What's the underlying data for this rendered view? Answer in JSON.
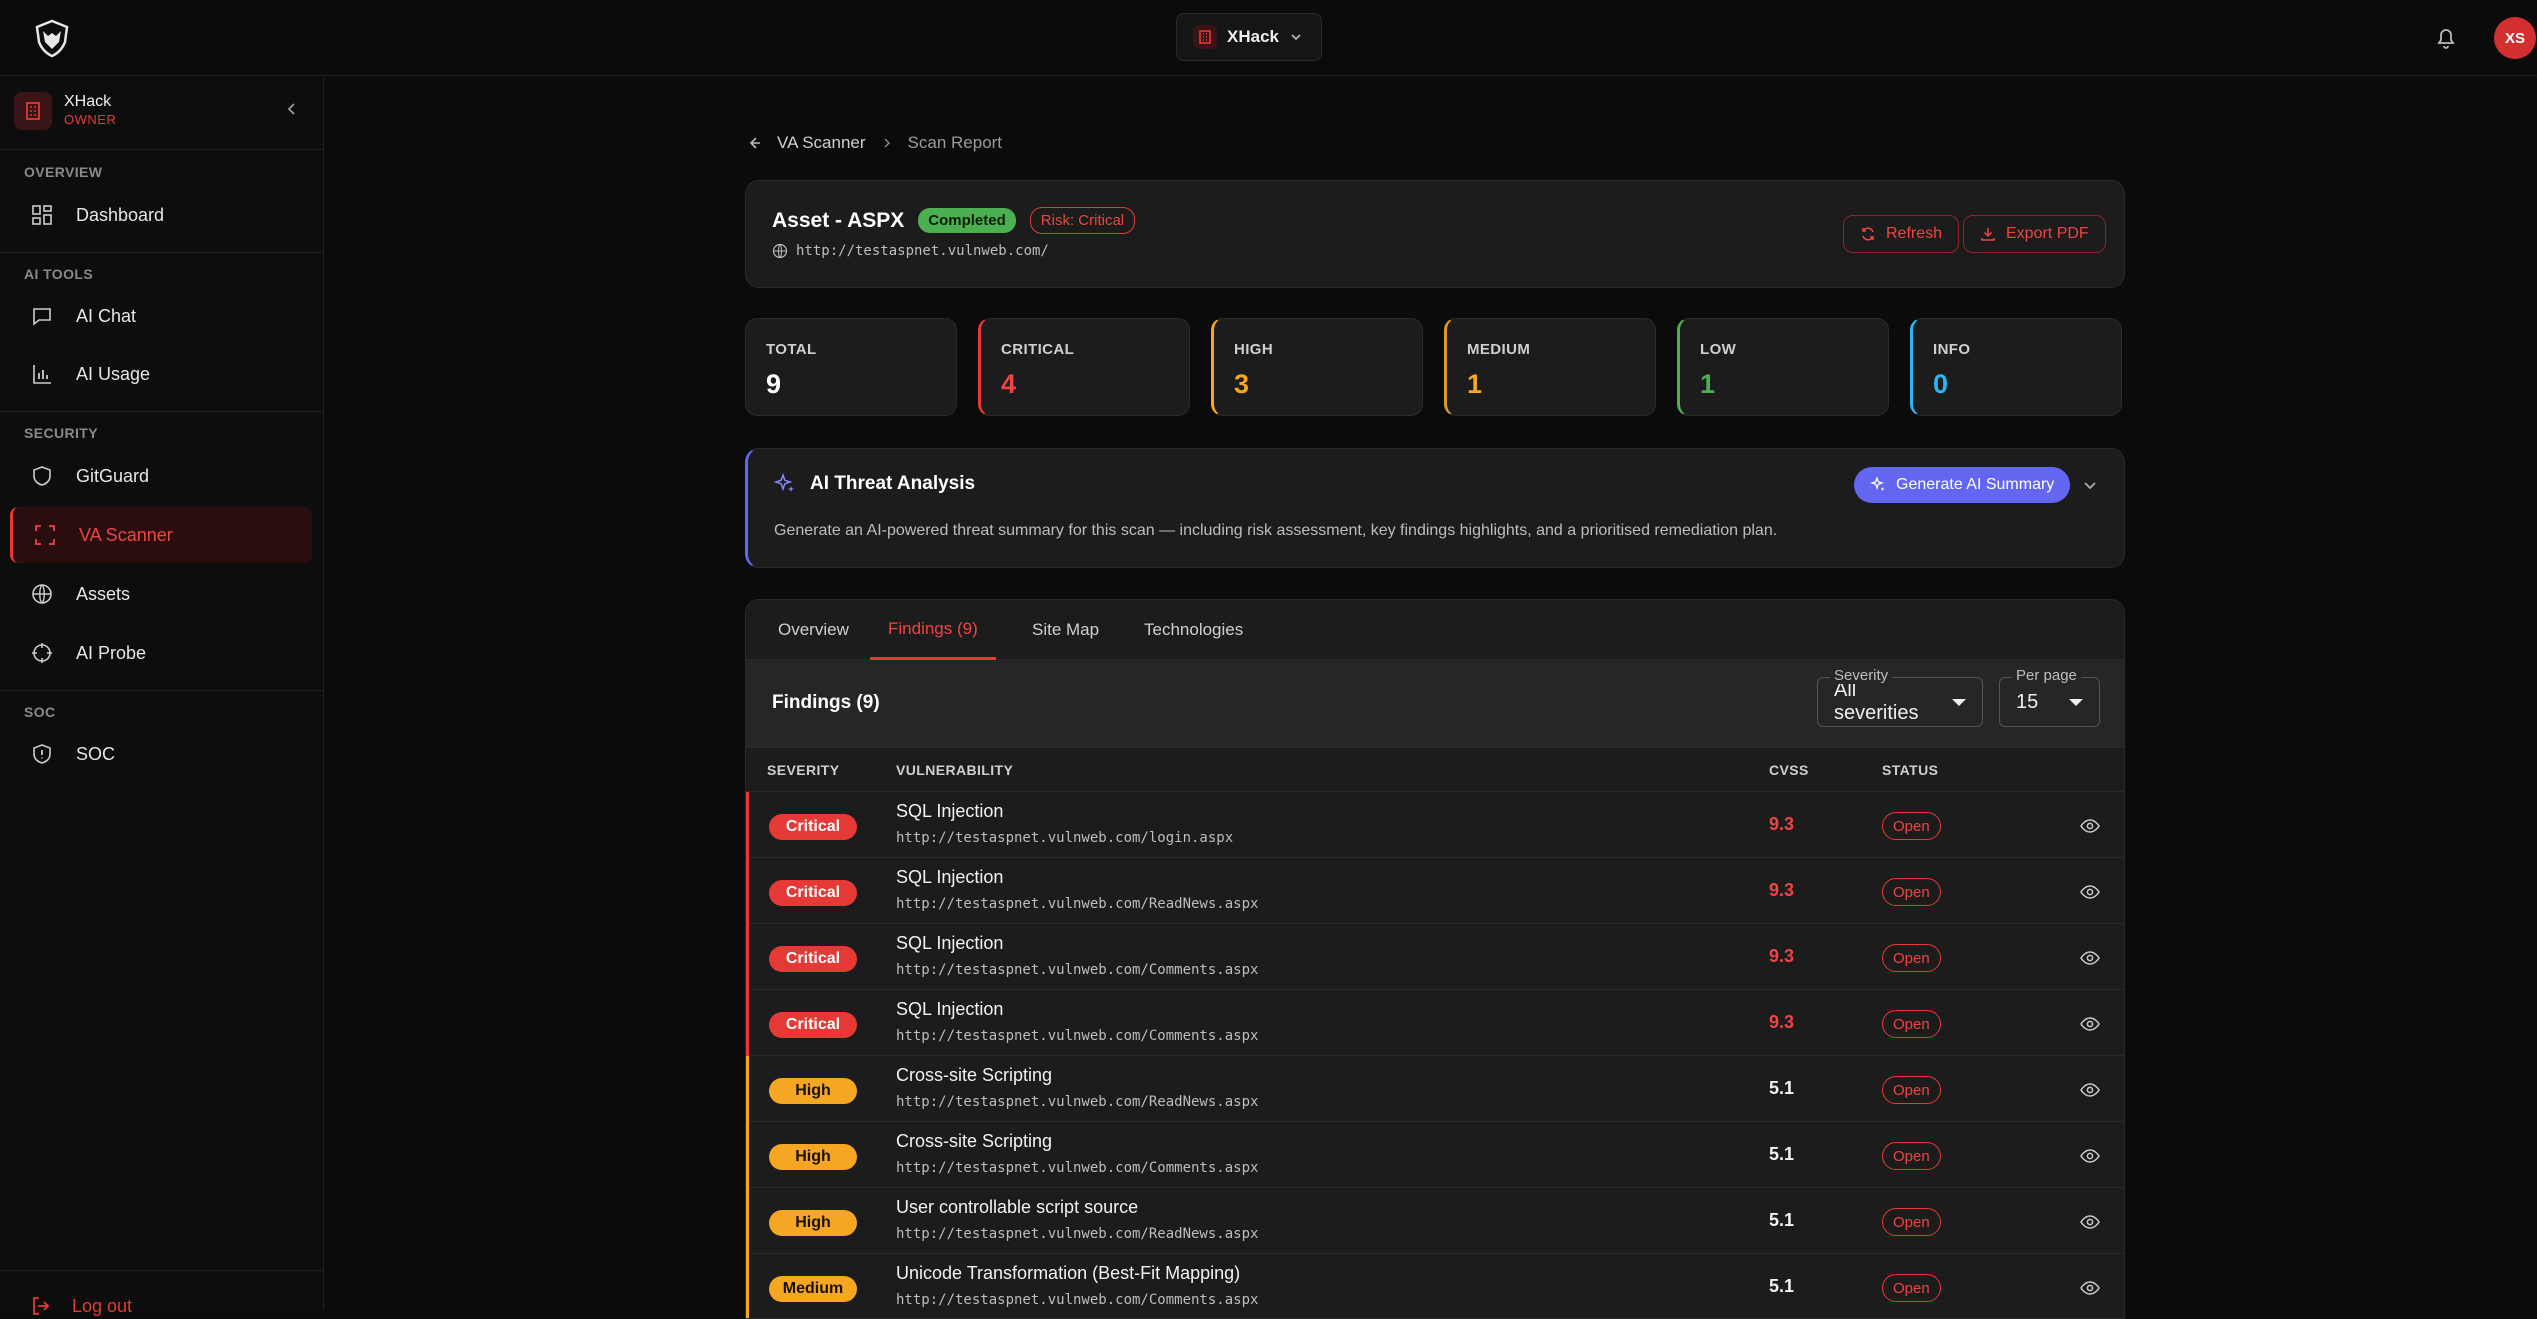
{
  "topbar": {
    "workspace": "XHack",
    "avatar_initials": "XS"
  },
  "sidebar": {
    "org_name": "XHack",
    "org_role": "OWNER",
    "sections": {
      "overview": "OVERVIEW",
      "ai_tools": "AI TOOLS",
      "security": "SECURITY",
      "soc": "SOC"
    },
    "items": {
      "dashboard": "Dashboard",
      "ai_chat": "AI Chat",
      "ai_usage": "AI Usage",
      "gitguard": "GitGuard",
      "va_scanner": "VA Scanner",
      "assets": "Assets",
      "ai_probe": "AI Probe",
      "soc": "SOC"
    },
    "logout": "Log out"
  },
  "breadcrumb": {
    "parent": "VA Scanner",
    "current": "Scan Report"
  },
  "asset": {
    "title": "Asset - ASPX",
    "status": "Completed",
    "risk": "Risk: Critical",
    "url": "http://testaspnet.vulnweb.com/",
    "refresh": "Refresh",
    "export": "Export PDF"
  },
  "stats": [
    {
      "label": "TOTAL",
      "value": "9",
      "color": "#ffffff",
      "accent": ""
    },
    {
      "label": "CRITICAL",
      "value": "4",
      "color": "#ef4444",
      "accent": "#e53935"
    },
    {
      "label": "HIGH",
      "value": "3",
      "color": "#f5a623",
      "accent": "#f5a623"
    },
    {
      "label": "MEDIUM",
      "value": "1",
      "color": "#f5a623",
      "accent": "#d99a2b"
    },
    {
      "label": "LOW",
      "value": "1",
      "color": "#4caf50",
      "accent": "#4caf50"
    },
    {
      "label": "INFO",
      "value": "0",
      "color": "#29b6f6",
      "accent": "#29b6f6"
    }
  ],
  "ai_analysis": {
    "title": "AI Threat Analysis",
    "button": "Generate AI Summary",
    "description": "Generate an AI-powered threat summary for this scan — including risk assessment, key findings highlights, and a prioritised remediation plan."
  },
  "tabs": [
    "Overview",
    "Findings (9)",
    "Site Map",
    "Technologies"
  ],
  "findings": {
    "title": "Findings (9)",
    "severity_filter": {
      "legend": "Severity",
      "value": "All severities"
    },
    "per_page": {
      "legend": "Per page",
      "value": "15"
    },
    "columns": {
      "severity": "SEVERITY",
      "vulnerability": "VULNERABILITY",
      "cvss": "CVSS",
      "status": "STATUS"
    },
    "rows": [
      {
        "severity": "Critical",
        "title": "SQL Injection",
        "url": "http://testaspnet.vulnweb.com/login.aspx",
        "cvss": "9.3",
        "status": "Open"
      },
      {
        "severity": "Critical",
        "title": "SQL Injection",
        "url": "http://testaspnet.vulnweb.com/ReadNews.aspx",
        "cvss": "9.3",
        "status": "Open"
      },
      {
        "severity": "Critical",
        "title": "SQL Injection",
        "url": "http://testaspnet.vulnweb.com/Comments.aspx",
        "cvss": "9.3",
        "status": "Open"
      },
      {
        "severity": "Critical",
        "title": "SQL Injection",
        "url": "http://testaspnet.vulnweb.com/Comments.aspx",
        "cvss": "9.3",
        "status": "Open"
      },
      {
        "severity": "High",
        "title": "Cross-site Scripting",
        "url": "http://testaspnet.vulnweb.com/ReadNews.aspx",
        "cvss": "5.1",
        "status": "Open"
      },
      {
        "severity": "High",
        "title": "Cross-site Scripting",
        "url": "http://testaspnet.vulnweb.com/Comments.aspx",
        "cvss": "5.1",
        "status": "Open"
      },
      {
        "severity": "High",
        "title": "User controllable script source",
        "url": "http://testaspnet.vulnweb.com/ReadNews.aspx",
        "cvss": "5.1",
        "status": "Open"
      },
      {
        "severity": "Medium",
        "title": "Unicode Transformation (Best-Fit Mapping)",
        "url": "http://testaspnet.vulnweb.com/Comments.aspx",
        "cvss": "5.1",
        "status": "Open"
      }
    ]
  },
  "colors": {
    "accent": "#e53935",
    "critical": "#e53935",
    "high": "#f5a623",
    "medium": "#f5a623",
    "ai": "#6366f1"
  }
}
